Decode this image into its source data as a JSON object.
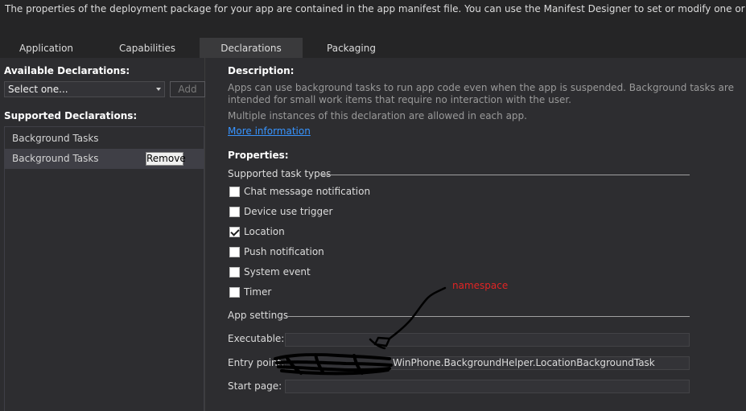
{
  "info_bar": {
    "text": "The properties of the deployment package for your app are contained in the app manifest file. You can use the Manifest Designer to set or modify one or more of the properties."
  },
  "tabs": [
    {
      "label": "Application",
      "active": false
    },
    {
      "label": "Capabilities",
      "active": false
    },
    {
      "label": "Declarations",
      "active": true
    },
    {
      "label": "Packaging",
      "active": false
    }
  ],
  "left": {
    "available_title": "Available Declarations:",
    "select_value": "Select one...",
    "add_label": "Add",
    "supported_title": "Supported Declarations:",
    "items": [
      {
        "label": "Background Tasks",
        "selected": false
      },
      {
        "label": "Background Tasks",
        "selected": true
      }
    ],
    "remove_label": "Remove"
  },
  "description": {
    "title": "Description:",
    "line1": "Apps can use background tasks to run app code even when the app is suspended. Background tasks are",
    "line2": "intended for small work items that require no interaction with the user.",
    "line3": "Multiple instances of this declaration are allowed in each app.",
    "link": "More information"
  },
  "properties": {
    "title": "Properties:",
    "task_types_label": "Supported task types",
    "tasks": [
      {
        "label": "Chat message notification",
        "checked": false
      },
      {
        "label": "Device use trigger",
        "checked": false
      },
      {
        "label": "Location",
        "checked": true
      },
      {
        "label": "Push notification",
        "checked": false
      },
      {
        "label": "System event",
        "checked": false
      },
      {
        "label": "Timer",
        "checked": false
      }
    ],
    "app_settings_label": "App settings",
    "executable_label": "Executable:",
    "executable_value": "",
    "entry_point_label": "Entry point:",
    "entry_point_value": "WinPhone.BackgroundHelper.LocationBackgroundTask",
    "start_page_label": "Start page:",
    "start_page_value": ""
  },
  "annotation": {
    "text": "namespace",
    "color": "#e02424"
  },
  "colors": {
    "background": "#2d2d30",
    "active_tab": "#3a3a3c",
    "link": "#3794ff"
  }
}
